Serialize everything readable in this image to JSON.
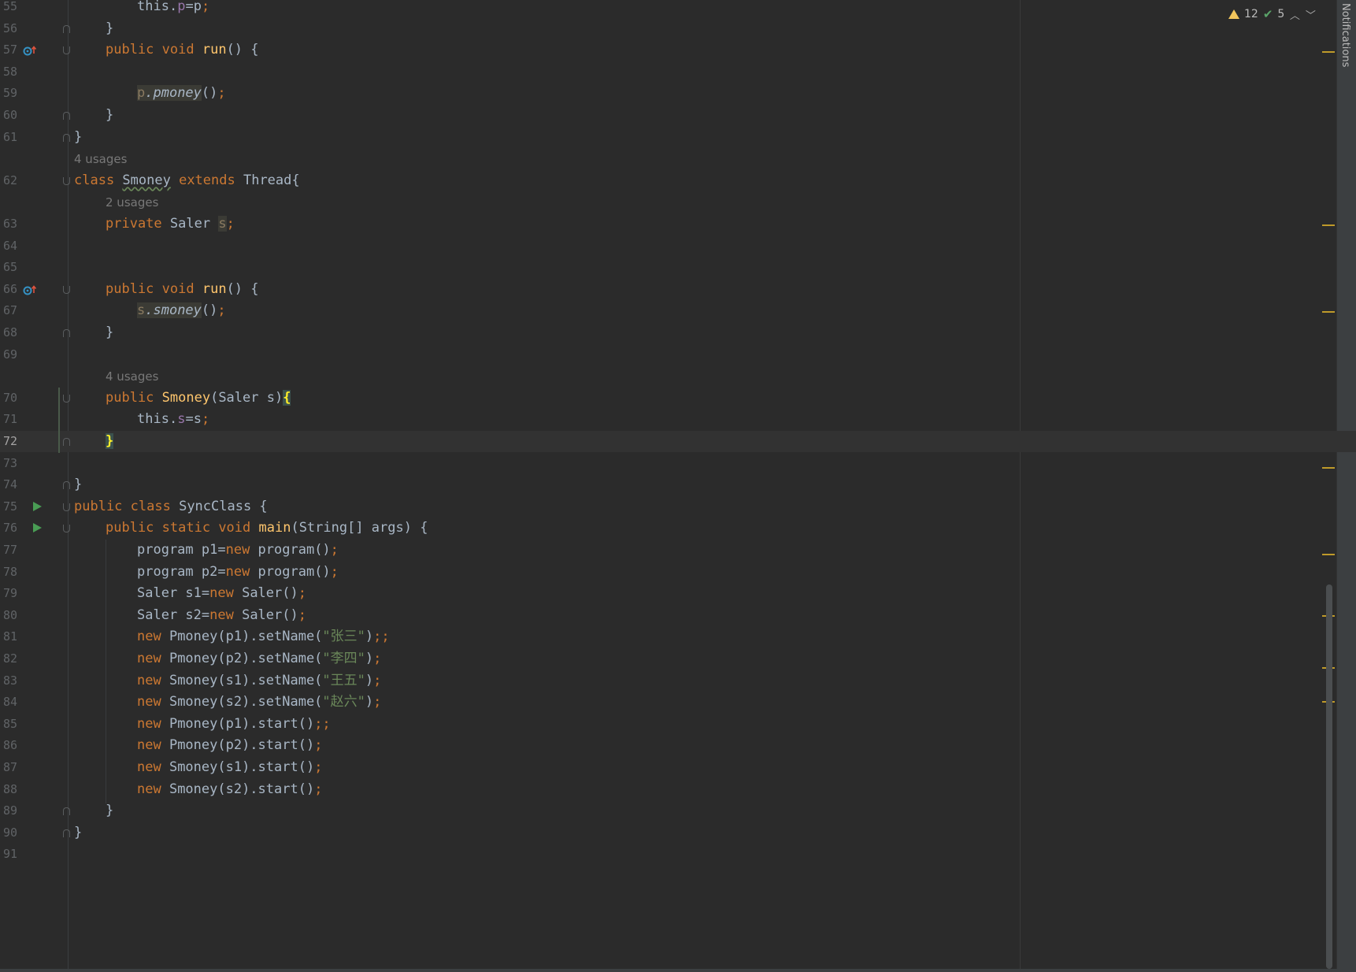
{
  "inspection": {
    "warnings_count": "12",
    "ok_count": "5"
  },
  "notifications_label": "Notifications",
  "lines": [
    {
      "n": "55",
      "segs": [
        [
          "this",
          ""
        ],
        [
          ".",
          ""
        ],
        [
          "p",
          "fld"
        ],
        [
          "=p",
          ""
        ],
        [
          ";",
          "semi"
        ]
      ],
      "indent": 2
    },
    {
      "n": "56",
      "segs": [
        [
          "}",
          ""
        ]
      ],
      "indent": 1
    },
    {
      "n": "57",
      "segs": [
        [
          "public ",
          "kw"
        ],
        [
          "void ",
          "kw"
        ],
        [
          "run",
          "fn"
        ],
        [
          "() {",
          ""
        ]
      ],
      "indent": 1
    },
    {
      "n": "58",
      "segs": [],
      "indent": 0
    },
    {
      "n": "59",
      "segs": [
        [
          "p",
          "dimhl"
        ],
        [
          ".pmoney",
          "ithl"
        ],
        [
          "()",
          ""
        ],
        [
          ";",
          "semi"
        ]
      ],
      "indent": 2
    },
    {
      "n": "60",
      "segs": [
        [
          "}",
          ""
        ]
      ],
      "indent": 1
    },
    {
      "n": "61",
      "segs": [
        [
          "}",
          ""
        ]
      ],
      "indent": 0
    },
    {
      "n": "62",
      "segs": [
        [
          "class ",
          "kw"
        ],
        [
          "Smoney",
          "wavy"
        ],
        [
          " extends ",
          "kw"
        ],
        [
          "Thread{",
          ""
        ]
      ],
      "indent": 0
    },
    {
      "n": "63",
      "segs": [
        [
          "private ",
          "kw"
        ],
        [
          "Saler ",
          ""
        ],
        [
          "s",
          "dimhl"
        ],
        [
          ";",
          "semi"
        ]
      ],
      "indent": 1
    },
    {
      "n": "64",
      "segs": [],
      "indent": 0
    },
    {
      "n": "65",
      "segs": [],
      "indent": 0
    },
    {
      "n": "66",
      "segs": [
        [
          "public ",
          "kw"
        ],
        [
          "void ",
          "kw"
        ],
        [
          "run",
          "fn"
        ],
        [
          "() {",
          ""
        ]
      ],
      "indent": 1
    },
    {
      "n": "67",
      "segs": [
        [
          "s",
          "dimhl"
        ],
        [
          ".smoney",
          "ithl"
        ],
        [
          "()",
          ""
        ],
        [
          ";",
          "semi"
        ]
      ],
      "indent": 2
    },
    {
      "n": "68",
      "segs": [
        [
          "}",
          ""
        ]
      ],
      "indent": 1
    },
    {
      "n": "69",
      "segs": [],
      "indent": 0
    },
    {
      "n": "70",
      "segs": [
        [
          "public ",
          "kw"
        ],
        [
          "Smoney",
          "fn"
        ],
        [
          "(Saler s)",
          ""
        ],
        [
          "{",
          "brace"
        ]
      ],
      "indent": 1
    },
    {
      "n": "71",
      "segs": [
        [
          "this",
          ""
        ],
        [
          ".",
          ""
        ],
        [
          "s",
          "fld"
        ],
        [
          "=s",
          ""
        ],
        [
          ";",
          "semi"
        ]
      ],
      "indent": 2
    },
    {
      "n": "72",
      "segs": [
        [
          "}",
          "brace"
        ]
      ],
      "indent": 1
    },
    {
      "n": "73",
      "segs": [],
      "indent": 0
    },
    {
      "n": "74",
      "segs": [
        [
          "}",
          ""
        ]
      ],
      "indent": 0
    },
    {
      "n": "75",
      "segs": [
        [
          "public ",
          "kw"
        ],
        [
          "class ",
          "kw"
        ],
        [
          "SyncClass {",
          ""
        ]
      ],
      "indent": 0
    },
    {
      "n": "76",
      "segs": [
        [
          "public ",
          "kw"
        ],
        [
          "static ",
          "kw"
        ],
        [
          "void ",
          "kw"
        ],
        [
          "main",
          "fn"
        ],
        [
          "(String[] args) {",
          ""
        ]
      ],
      "indent": 1
    },
    {
      "n": "77",
      "segs": [
        [
          "program p1=",
          ""
        ],
        [
          "new ",
          "kw"
        ],
        [
          "program()",
          ""
        ],
        [
          ";",
          "semi"
        ]
      ],
      "indent": 2
    },
    {
      "n": "78",
      "segs": [
        [
          "program p2=",
          ""
        ],
        [
          "new ",
          "kw"
        ],
        [
          "program()",
          ""
        ],
        [
          ";",
          "semi"
        ]
      ],
      "indent": 2
    },
    {
      "n": "79",
      "segs": [
        [
          "Saler s1=",
          ""
        ],
        [
          "new ",
          "kw"
        ],
        [
          "Saler()",
          ""
        ],
        [
          ";",
          "semi"
        ]
      ],
      "indent": 2
    },
    {
      "n": "80",
      "segs": [
        [
          "Saler s2=",
          ""
        ],
        [
          "new ",
          "kw"
        ],
        [
          "Saler()",
          ""
        ],
        [
          ";",
          "semi"
        ]
      ],
      "indent": 2
    },
    {
      "n": "81",
      "segs": [
        [
          "new ",
          "kw"
        ],
        [
          "Pmoney(p1).setName(",
          ""
        ],
        [
          "\"张三\"",
          "str"
        ],
        [
          ")",
          ""
        ],
        [
          ";;",
          "semi"
        ]
      ],
      "indent": 2
    },
    {
      "n": "82",
      "segs": [
        [
          "new ",
          "kw"
        ],
        [
          "Pmoney(p2).setName(",
          ""
        ],
        [
          "\"李四\"",
          "str"
        ],
        [
          ")",
          ""
        ],
        [
          ";",
          "semi"
        ]
      ],
      "indent": 2
    },
    {
      "n": "83",
      "segs": [
        [
          "new ",
          "kw"
        ],
        [
          "Smoney(s1).setName(",
          ""
        ],
        [
          "\"王五\"",
          "str"
        ],
        [
          ")",
          ""
        ],
        [
          ";",
          "semi"
        ]
      ],
      "indent": 2
    },
    {
      "n": "84",
      "segs": [
        [
          "new ",
          "kw"
        ],
        [
          "Smoney(s2).setName(",
          ""
        ],
        [
          "\"赵六\"",
          "str"
        ],
        [
          ")",
          ""
        ],
        [
          ";",
          "semi"
        ]
      ],
      "indent": 2
    },
    {
      "n": "85",
      "segs": [
        [
          "new ",
          "kw"
        ],
        [
          "Pmoney(p1).start()",
          ""
        ],
        [
          ";;",
          "semi"
        ]
      ],
      "indent": 2
    },
    {
      "n": "86",
      "segs": [
        [
          "new ",
          "kw"
        ],
        [
          "Pmoney(p2).start()",
          ""
        ],
        [
          ";",
          "semi"
        ]
      ],
      "indent": 2
    },
    {
      "n": "87",
      "segs": [
        [
          "new ",
          "kw"
        ],
        [
          "Smoney(s1).start()",
          ""
        ],
        [
          ";",
          "semi"
        ]
      ],
      "indent": 2
    },
    {
      "n": "88",
      "segs": [
        [
          "new ",
          "kw"
        ],
        [
          "Smoney(s2).start()",
          ""
        ],
        [
          ";",
          "semi"
        ]
      ],
      "indent": 2
    },
    {
      "n": "89",
      "segs": [
        [
          "}",
          ""
        ]
      ],
      "indent": 1
    },
    {
      "n": "90",
      "segs": [
        [
          "}",
          ""
        ]
      ],
      "indent": 0
    },
    {
      "n": "91",
      "segs": [],
      "indent": 0
    }
  ],
  "hints": [
    {
      "before": "62",
      "text": "4 usages",
      "indent": 0
    },
    {
      "before": "63",
      "text": "2 usages",
      "indent": 1
    },
    {
      "before": "70",
      "text": "4 usages",
      "indent": 1
    }
  ],
  "caret_line": "72",
  "icons": {
    "override": [
      "57",
      "66"
    ],
    "run": [
      "75",
      "76"
    ]
  },
  "colors": {
    "background": "#2b2b2b",
    "keyword": "#cc7832",
    "function": "#ffc66d",
    "field": "#9876aa",
    "string": "#6a8759",
    "text": "#a9b7c6",
    "warning_mark": "#bf9a2a"
  }
}
